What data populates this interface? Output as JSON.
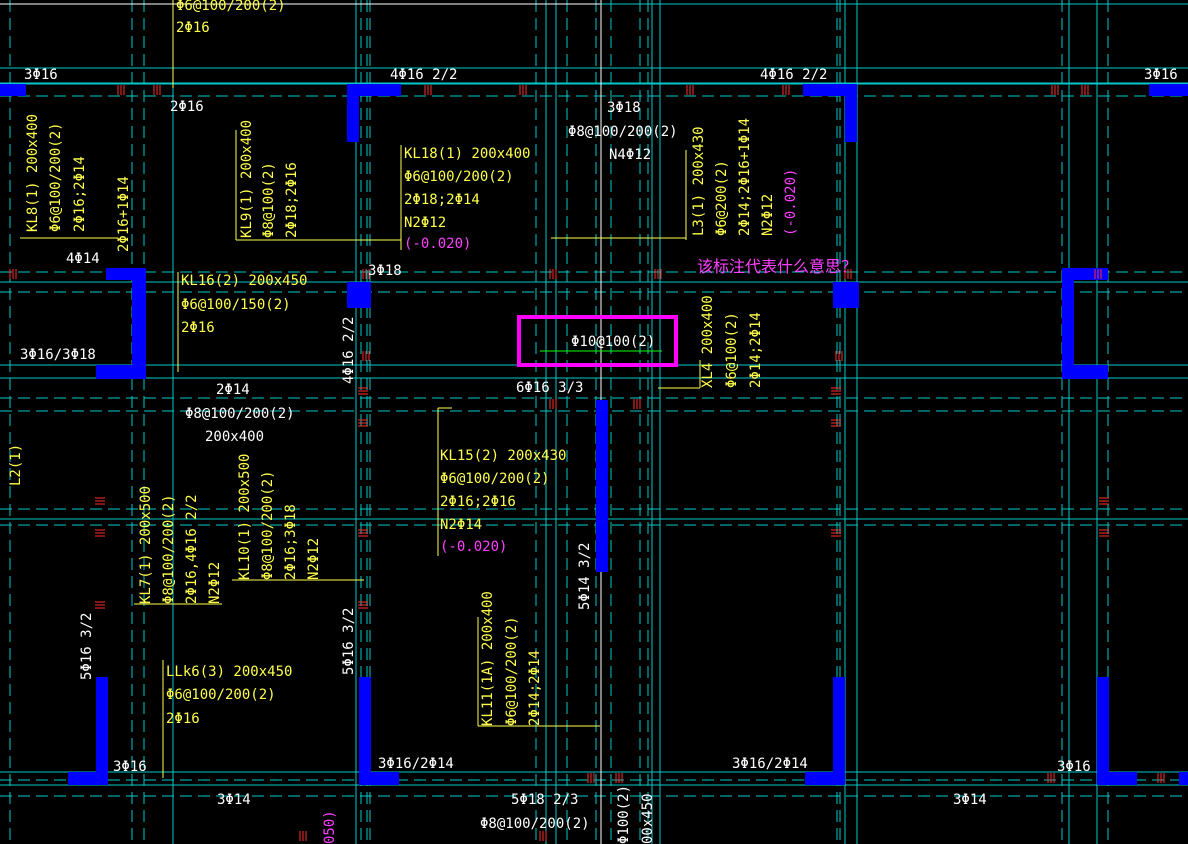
{
  "colors": {
    "background": "#000000",
    "grid": "#00c8c8",
    "beam": "#00c8c8",
    "column": "#0000ff",
    "yellow_text": "#ffff4d",
    "white_text": "#ffffff",
    "magenta_text": "#ff40ff",
    "highlight_box": "#ff00ff",
    "rebar_tick": "#ff3030"
  },
  "question": "该标注代表什么意思？",
  "highlight": {
    "annotation": "Φ10@100(2)"
  },
  "labels": {
    "t1": "Φ6@100/200(2)",
    "t2": "2Φ16",
    "t3": "3Φ16",
    "t4": "4Φ16 2/2",
    "t5": "4Φ16 2/2",
    "t6": "3Φ16",
    "t7": "2Φ16",
    "t8": "3Φ18",
    "t9": "Φ8@100/200(2)",
    "t10": "N4Φ12",
    "kl18_1": "KL18(1) 200x400",
    "kl18_2": "Φ6@100/200(2)",
    "kl18_3": "2Φ18;2Φ14",
    "kl18_4": "N2Φ12",
    "kl18_5": "(-0.020)",
    "kl8_1": "KL8(1) 200x400",
    "kl8_2": "Φ6@100/200(2)",
    "kl8_3": "2Φ16;2Φ14",
    "kl8_4": "2Φ16+1Φ14",
    "kl9_1": "KL9(1) 200x400",
    "kl9_2": "Φ8@100(2)",
    "kl9_3": "2Φ18;2Φ16",
    "l3_1": "L3(1) 200x430",
    "l3_2": "Φ6@200(2)",
    "l3_3": "2Φ14;2Φ16+1Φ14",
    "l3_4": "N2Φ12",
    "l3_5": "(-0.020)",
    "t11": "4Φ14",
    "t12": "3Φ18",
    "kl16_1": "KL16(2) 200x450",
    "kl16_2": "Φ6@100/150(2)",
    "kl16_3": "2Φ16",
    "t13": "3Φ16/3Φ18",
    "t14": "4Φ16 2/2",
    "t15": "6Φ16 3/3",
    "xl4_1": "XL4 200x400",
    "xl4_2": "Φ6@100(2)",
    "xl4_3": "2Φ14;2Φ14",
    "t16": "2Φ14",
    "t17": "Φ8@100/200(2)",
    "t18": "200x400",
    "l2": "L2(1)",
    "kl15_1": "KL15(2) 200x430",
    "kl15_2": "Φ6@100/200(2)",
    "kl15_3": "2Φ16;2Φ16",
    "kl15_4": "N2Φ14",
    "kl15_5": "(-0.020)",
    "kl7_1": "KL7(1) 200x500",
    "kl7_2": "Φ8@100/200(2)",
    "kl7_3": "2Φ16,4Φ16 2/2",
    "kl7_4": "N2Φ12",
    "kl10_1": "KL10(1) 200x500",
    "kl10_2": "Φ8@100/200(2)",
    "kl10_3": "2Φ16;3Φ18",
    "kl10_4": "N2Φ12",
    "t19": "5Φ14 3/2",
    "t20": "5Φ16 3/2",
    "t21": "5Φ16 3/2",
    "kl11_1": "KL11(1A) 200x400",
    "kl11_2": "Φ6@100/200(2)",
    "kl11_3": "2Φ14;2Φ14",
    "llk6_1": "LLk6(3) 200x450",
    "llk6_2": "Φ6@100/200(2)",
    "llk6_3": "2Φ16",
    "t22": "3Φ16",
    "t23": "3Φ16/2Φ14",
    "t24": "3Φ16/2Φ14",
    "t25": "3Φ16",
    "t26": "3Φ14",
    "t27": "5Φ18 2/3",
    "t28": "Φ8@100/200(2)",
    "t29": "3Φ14",
    "t30": "Φ100(2)",
    "t31": "00x450",
    "t32": "050)"
  }
}
